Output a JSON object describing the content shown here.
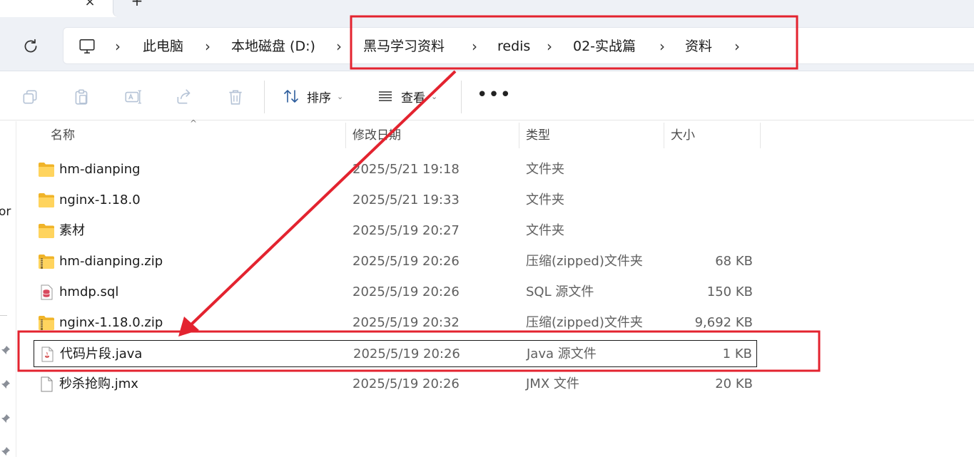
{
  "tab": {
    "close_glyph": "×",
    "new_glyph": "+"
  },
  "address": {
    "pc_icon": "computer-icon",
    "separator": "›",
    "crumbs": [
      "此电脑",
      "本地磁盘 (D:)",
      "黑马学习资料",
      "redis",
      "02-实战篇",
      "资料"
    ]
  },
  "toolbar": {
    "icons": [
      "copy-icon",
      "paste-icon",
      "rename-icon",
      "share-icon",
      "delete-icon"
    ],
    "sort_label": "排序",
    "view_label": "查看",
    "dropdown_glyph": "⌄",
    "more_glyph": "•••"
  },
  "nav": {
    "partial_text": "or"
  },
  "columns": {
    "name": "名称",
    "date": "修改日期",
    "type": "类型",
    "size": "大小",
    "sort_glyph": "^"
  },
  "files": [
    {
      "icon": "folder-icon",
      "name": "hm-dianping",
      "date": "2025/5/21 19:18",
      "type": "文件夹",
      "size": ""
    },
    {
      "icon": "folder-icon",
      "name": "nginx-1.18.0",
      "date": "2025/5/21 19:33",
      "type": "文件夹",
      "size": ""
    },
    {
      "icon": "folder-icon",
      "name": "素材",
      "date": "2025/5/19 20:27",
      "type": "文件夹",
      "size": ""
    },
    {
      "icon": "zip-folder-icon",
      "name": "hm-dianping.zip",
      "date": "2025/5/19 20:26",
      "type": "压缩(zipped)文件夹",
      "size": "68 KB"
    },
    {
      "icon": "sql-file-icon",
      "name": "hmdp.sql",
      "date": "2025/5/19 20:26",
      "type": "SQL 源文件",
      "size": "150 KB"
    },
    {
      "icon": "zip-folder-icon",
      "name": "nginx-1.18.0.zip",
      "date": "2025/5/19 20:32",
      "type": "压缩(zipped)文件夹",
      "size": "9,692 KB"
    },
    {
      "icon": "java-file-icon",
      "name": "代码片段.java",
      "date": "2025/5/19 20:26",
      "type": "Java 源文件",
      "size": "1 KB"
    },
    {
      "icon": "file-icon",
      "name": "秒杀抢购.jmx",
      "date": "2025/5/19 20:26",
      "type": "JMX 文件",
      "size": "20 KB"
    }
  ],
  "annotation": {
    "color": "#e3232f"
  }
}
